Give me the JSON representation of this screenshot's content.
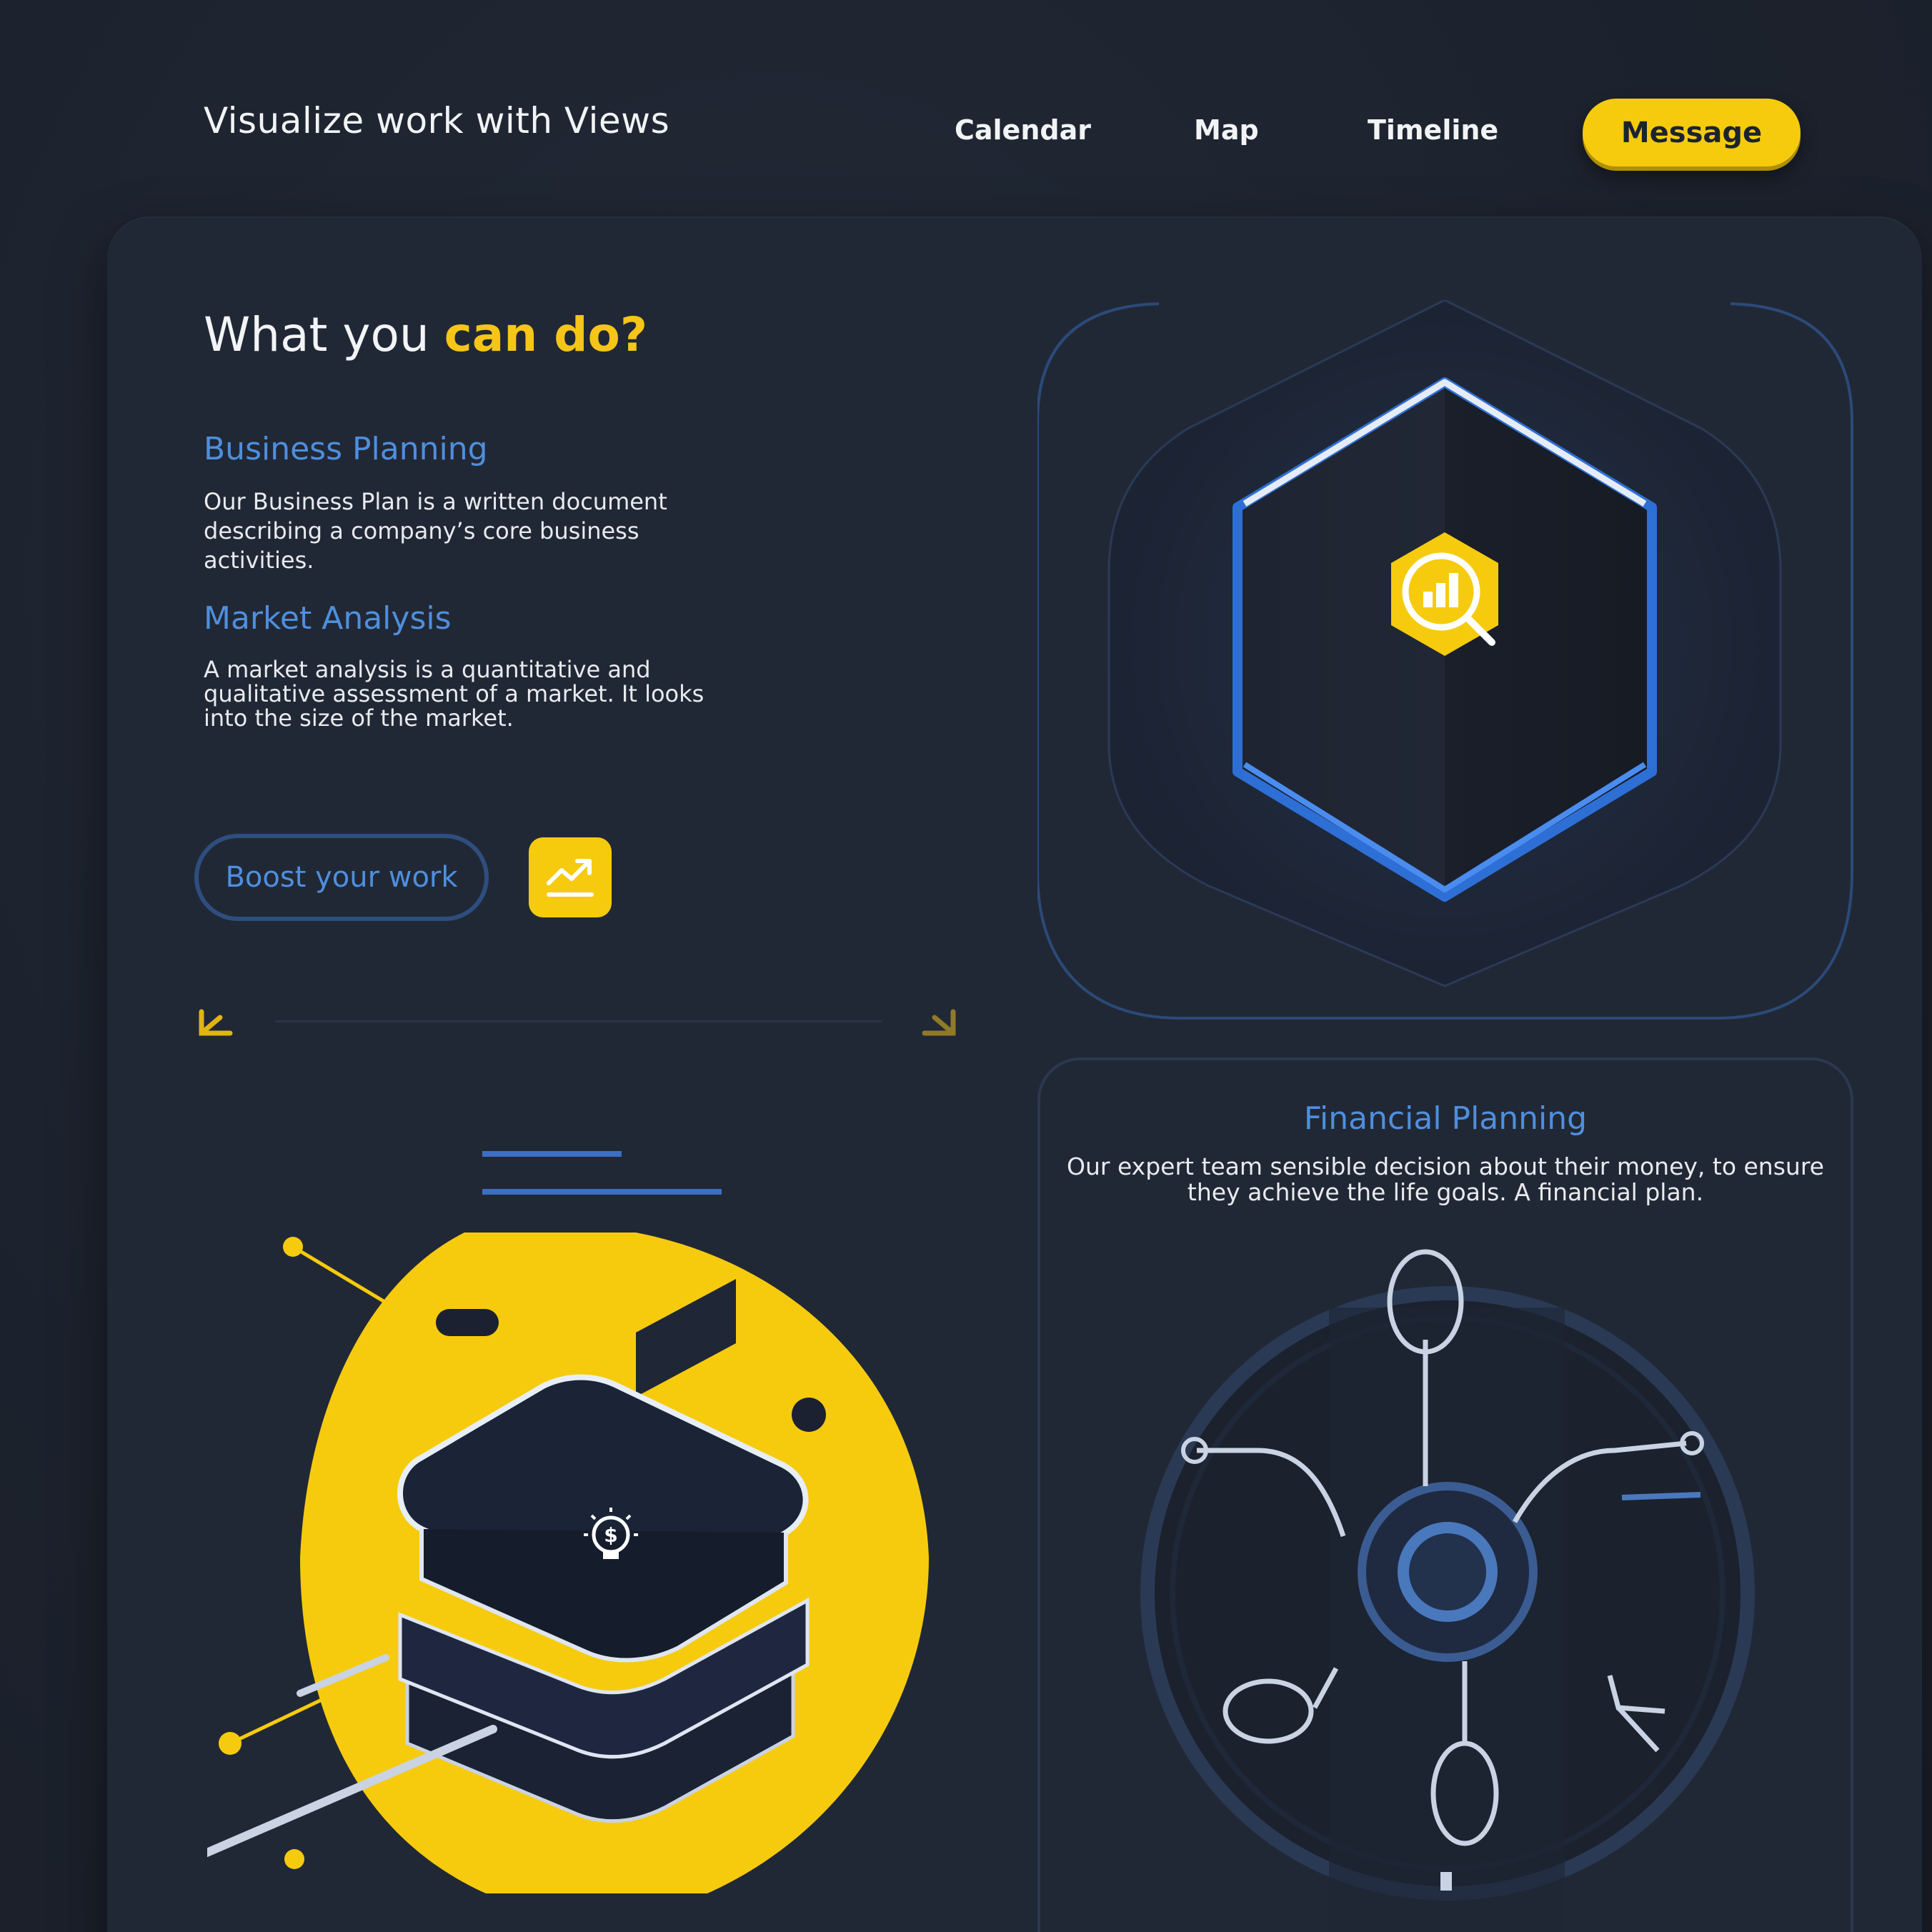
{
  "header": {
    "title": "Visualize work with Views",
    "nav": [
      {
        "label": "Calendar"
      },
      {
        "label": "Map"
      },
      {
        "label": "Timeline"
      }
    ],
    "message_button": "Message"
  },
  "hero": {
    "headline_plain": "What you ",
    "headline_accent": "can do?"
  },
  "sections": [
    {
      "title": "Business Planning",
      "body": "Our Business Plan is a written document describing a company’s core business activities."
    },
    {
      "title": "Market Analysis",
      "body": "A market analysis is a quantitative and qualitative assessment of a market. It looks into the size of the market."
    }
  ],
  "actions": {
    "boost_label": "Boost your work",
    "trend_icon": "trending-up-icon"
  },
  "financial": {
    "title": "Financial Planning",
    "body": "Our expert team sensible decision about their money, to ensure they achieve the life goals. A financial plan."
  },
  "icons": {
    "hex_badge": "chart-search-icon",
    "bulb": "lightbulb-dollar-icon",
    "arrow_left": "arrow-down-left-icon",
    "arrow_right": "arrow-down-right-icon"
  },
  "colors": {
    "background": "#1d232f",
    "accent_yellow": "#f6cb0e",
    "accent_blue": "#4e8fde",
    "text": "#f2f3f5"
  }
}
